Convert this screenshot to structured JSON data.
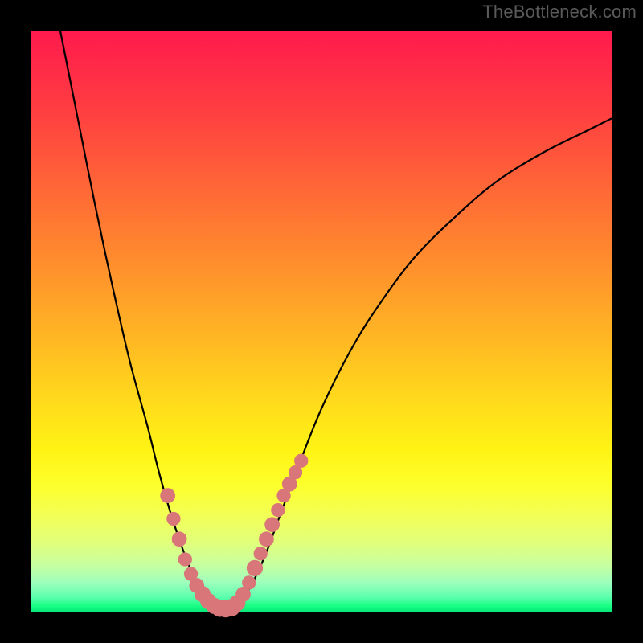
{
  "watermark": {
    "text": "TheBottleneck.com"
  },
  "colors": {
    "background": "#000000",
    "gradient_top": "#ff1a4d",
    "gradient_bottom": "#05e878",
    "curve": "#000000",
    "dots": "#d87679"
  },
  "chart_data": {
    "type": "line",
    "title": "",
    "xlabel": "",
    "ylabel": "",
    "xlim": [
      0,
      100
    ],
    "ylim": [
      0,
      100
    ],
    "grid": false,
    "legend": false,
    "series": [
      {
        "name": "left-curve",
        "description": "Steep descending curve from upper-left to valley floor",
        "points": [
          {
            "x": 5,
            "y": 100
          },
          {
            "x": 8,
            "y": 85
          },
          {
            "x": 11,
            "y": 70
          },
          {
            "x": 14,
            "y": 56
          },
          {
            "x": 17,
            "y": 43
          },
          {
            "x": 20,
            "y": 32
          },
          {
            "x": 22,
            "y": 24
          },
          {
            "x": 24,
            "y": 17
          },
          {
            "x": 26,
            "y": 11
          },
          {
            "x": 28,
            "y": 6
          },
          {
            "x": 30,
            "y": 2.5
          },
          {
            "x": 31,
            "y": 1.2
          },
          {
            "x": 32,
            "y": 0.6
          },
          {
            "x": 33,
            "y": 0.4
          }
        ]
      },
      {
        "name": "right-curve",
        "description": "Ascending curve from valley floor toward upper-right",
        "points": [
          {
            "x": 33,
            "y": 0.4
          },
          {
            "x": 35,
            "y": 1.0
          },
          {
            "x": 37,
            "y": 3
          },
          {
            "x": 40,
            "y": 9
          },
          {
            "x": 43,
            "y": 17
          },
          {
            "x": 46,
            "y": 25
          },
          {
            "x": 50,
            "y": 35
          },
          {
            "x": 55,
            "y": 45
          },
          {
            "x": 60,
            "y": 53
          },
          {
            "x": 66,
            "y": 61
          },
          {
            "x": 73,
            "y": 68
          },
          {
            "x": 80,
            "y": 74
          },
          {
            "x": 88,
            "y": 79
          },
          {
            "x": 96,
            "y": 83
          },
          {
            "x": 100,
            "y": 85
          }
        ]
      }
    ],
    "markers": [
      {
        "series": "left-curve",
        "x": 23.5,
        "y": 20,
        "r": 1.3
      },
      {
        "series": "left-curve",
        "x": 24.5,
        "y": 16,
        "r": 1.2
      },
      {
        "series": "left-curve",
        "x": 25.5,
        "y": 12.5,
        "r": 1.3
      },
      {
        "series": "left-curve",
        "x": 26.5,
        "y": 9,
        "r": 1.2
      },
      {
        "series": "left-curve",
        "x": 27.5,
        "y": 6.5,
        "r": 1.2
      },
      {
        "series": "left-curve",
        "x": 28.5,
        "y": 4.5,
        "r": 1.3
      },
      {
        "series": "left-curve",
        "x": 29.5,
        "y": 3,
        "r": 1.4
      },
      {
        "series": "valley",
        "x": 30.5,
        "y": 1.8,
        "r": 1.4
      },
      {
        "series": "valley",
        "x": 31.5,
        "y": 1.0,
        "r": 1.4
      },
      {
        "series": "valley",
        "x": 32.5,
        "y": 0.6,
        "r": 1.5
      },
      {
        "series": "valley",
        "x": 33.5,
        "y": 0.5,
        "r": 1.5
      },
      {
        "series": "valley",
        "x": 34.5,
        "y": 0.7,
        "r": 1.5
      },
      {
        "series": "right-curve",
        "x": 35.5,
        "y": 1.5,
        "r": 1.4
      },
      {
        "series": "right-curve",
        "x": 36.5,
        "y": 3,
        "r": 1.3
      },
      {
        "series": "right-curve",
        "x": 37.5,
        "y": 5,
        "r": 1.2
      },
      {
        "series": "right-curve",
        "x": 38.5,
        "y": 7.5,
        "r": 1.4
      },
      {
        "series": "right-curve",
        "x": 39.5,
        "y": 10,
        "r": 1.2
      },
      {
        "series": "right-curve",
        "x": 40.5,
        "y": 12.5,
        "r": 1.3
      },
      {
        "series": "right-curve",
        "x": 41.5,
        "y": 15,
        "r": 1.3
      },
      {
        "series": "right-curve",
        "x": 42.5,
        "y": 17.5,
        "r": 1.2
      },
      {
        "series": "right-curve",
        "x": 43.5,
        "y": 20,
        "r": 1.2
      },
      {
        "series": "right-curve",
        "x": 44.5,
        "y": 22,
        "r": 1.3
      },
      {
        "series": "right-curve",
        "x": 45.5,
        "y": 24,
        "r": 1.2
      },
      {
        "series": "right-curve",
        "x": 46.5,
        "y": 26,
        "r": 1.2
      }
    ]
  }
}
